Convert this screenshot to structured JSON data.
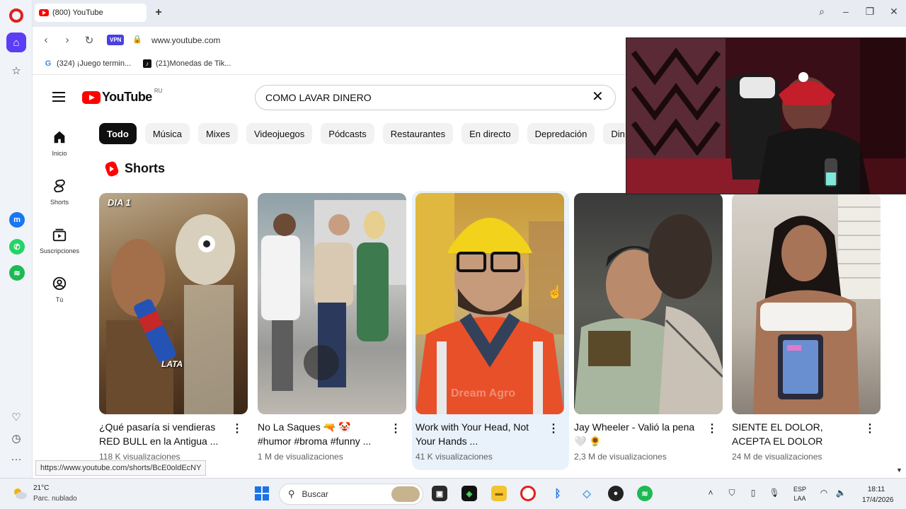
{
  "browser": {
    "tab_title": "(800) YouTube",
    "url": "www.youtube.com",
    "vpn_label": "VPN",
    "bookmarks": [
      {
        "label": "(324) ¡Juego termin..."
      },
      {
        "label": "(21)Monedas de Tik..."
      }
    ],
    "status_url": "https://www.youtube.com/shorts/BcE0oldEcNY"
  },
  "youtube": {
    "logo_text": "YouTube",
    "logo_country": "RU",
    "search_value": "COMO LAVAR DINERO",
    "nav": [
      {
        "label": "Inicio",
        "icon": "home-icon"
      },
      {
        "label": "Shorts",
        "icon": "shorts-icon"
      },
      {
        "label": "Suscripciones",
        "icon": "subscriptions-icon"
      },
      {
        "label": "Tú",
        "icon": "you-icon"
      }
    ],
    "chips": [
      "Todo",
      "Música",
      "Mixes",
      "Videojuegos",
      "Pódcasts",
      "Restaurantes",
      "En directo",
      "Depredación",
      "Din"
    ],
    "shorts_section_title": "Shorts",
    "shorts": [
      {
        "title": "¿Qué pasaría si vendieras RED BULL en la Antigua ...",
        "views": "118 K visualizaciones",
        "label_top": "DIA 1",
        "label_mid": "LATA"
      },
      {
        "title": "No La Saques 🔫 🤡 #humor #broma #funny ...",
        "views": "1 M de visualizaciones"
      },
      {
        "title": "Work with Your Head, Not Your Hands ...",
        "views": "41 K visualizaciones",
        "watermark": "Dream Agro"
      },
      {
        "title": "Jay Wheeler - Valió la pena 🤍 🌻",
        "views": "2,3 M de visualizaciones"
      },
      {
        "title": "SIENTE EL DOLOR, ACEPTA EL DOLOR",
        "views": "24 M de visualizaciones"
      }
    ]
  },
  "taskbar": {
    "weather_temp": "21°C",
    "weather_desc": "Parc. nublado",
    "search_placeholder": "Buscar",
    "lang_line1": "ESP",
    "lang_line2": "LAA",
    "time": "18:11",
    "date": "17/4/2026"
  },
  "colors": {
    "youtube_red": "#ff0000",
    "opera_red": "#e1201c",
    "opera_accent": "#5b3df6"
  }
}
